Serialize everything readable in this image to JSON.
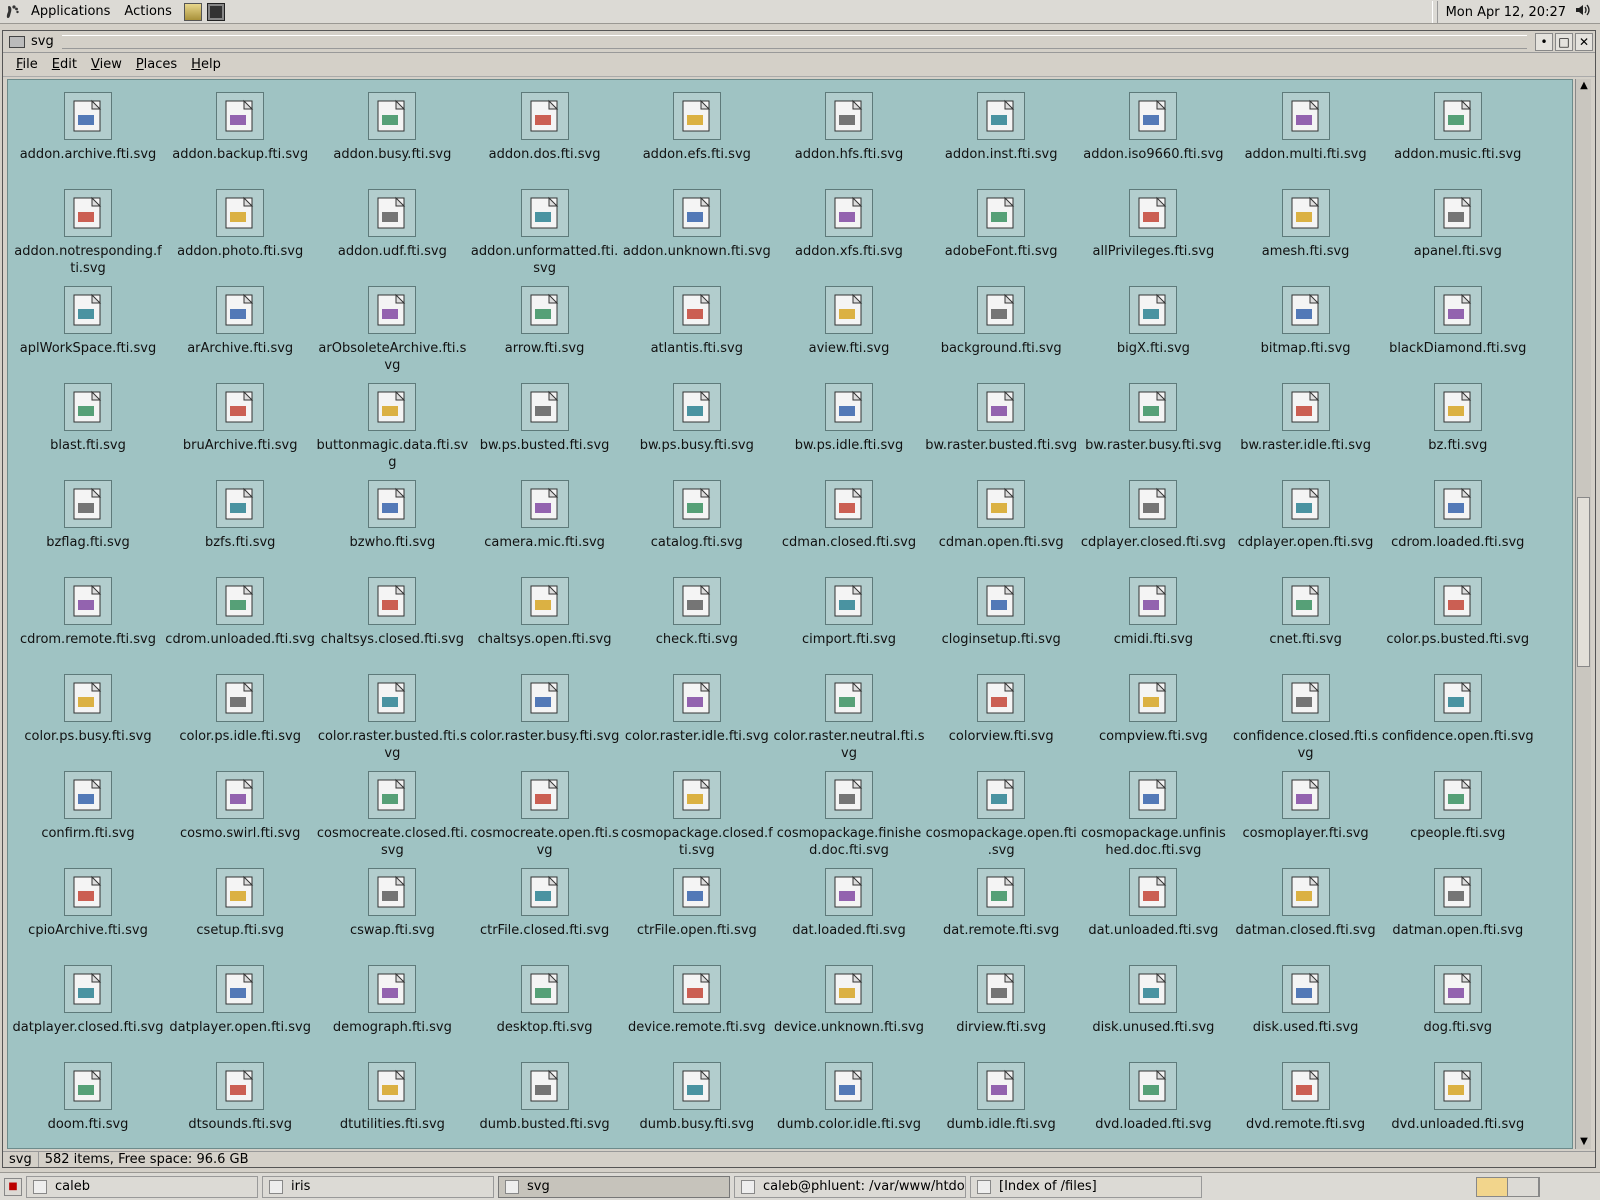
{
  "top_panel": {
    "menus": [
      "Applications",
      "Actions"
    ],
    "clock": "Mon Apr 12, 20:27",
    "icons": [
      "gnome-foot-icon",
      "notes-launcher-icon",
      "terminal-launcher-icon",
      "volume-icon"
    ]
  },
  "window": {
    "title": "svg",
    "menus": [
      {
        "key": "F",
        "rest": "ile"
      },
      {
        "key": "E",
        "rest": "dit"
      },
      {
        "key": "V",
        "rest": "iew"
      },
      {
        "key": "P",
        "rest": "laces"
      },
      {
        "key": "H",
        "rest": "elp"
      }
    ]
  },
  "files": [
    [
      "addon.archive.fti.svg",
      "addon.backup.fti.svg",
      "addon.busy.fti.svg",
      "addon.dos.fti.svg",
      "addon.efs.fti.svg",
      "addon.hfs.fti.svg",
      "addon.inst.fti.svg",
      "addon.iso9660.fti.svg",
      "addon.multi.fti.svg",
      "addon.music.fti.svg"
    ],
    [
      "addon.notresponding.fti.svg",
      "addon.photo.fti.svg",
      "addon.udf.fti.svg",
      "addon.unformatted.fti.svg",
      "addon.unknown.fti.svg",
      "addon.xfs.fti.svg",
      "adobeFont.fti.svg",
      "allPrivileges.fti.svg",
      "amesh.fti.svg",
      "apanel.fti.svg"
    ],
    [
      "aplWorkSpace.fti.svg",
      "arArchive.fti.svg",
      "arObsoleteArchive.fti.svg",
      "arrow.fti.svg",
      "atlantis.fti.svg",
      "aview.fti.svg",
      "background.fti.svg",
      "bigX.fti.svg",
      "bitmap.fti.svg",
      "blackDiamond.fti.svg"
    ],
    [
      "blast.fti.svg",
      "bruArchive.fti.svg",
      "buttonmagic.data.fti.svg",
      "bw.ps.busted.fti.svg",
      "bw.ps.busy.fti.svg",
      "bw.ps.idle.fti.svg",
      "bw.raster.busted.fti.svg",
      "bw.raster.busy.fti.svg",
      "bw.raster.idle.fti.svg",
      "bz.fti.svg"
    ],
    [
      "bzflag.fti.svg",
      "bzfs.fti.svg",
      "bzwho.fti.svg",
      "camera.mic.fti.svg",
      "catalog.fti.svg",
      "cdman.closed.fti.svg",
      "cdman.open.fti.svg",
      "cdplayer.closed.fti.svg",
      "cdplayer.open.fti.svg",
      "cdrom.loaded.fti.svg"
    ],
    [
      "cdrom.remote.fti.svg",
      "cdrom.unloaded.fti.svg",
      "chaltsys.closed.fti.svg",
      "chaltsys.open.fti.svg",
      "check.fti.svg",
      "cimport.fti.svg",
      "cloginsetup.fti.svg",
      "cmidi.fti.svg",
      "cnet.fti.svg",
      "color.ps.busted.fti.svg"
    ],
    [
      "color.ps.busy.fti.svg",
      "color.ps.idle.fti.svg",
      "color.raster.busted.fti.svg",
      "color.raster.busy.fti.svg",
      "color.raster.idle.fti.svg",
      "color.raster.neutral.fti.svg",
      "colorview.fti.svg",
      "compview.fti.svg",
      "confidence.closed.fti.svg",
      "confidence.open.fti.svg"
    ],
    [
      "confirm.fti.svg",
      "cosmo.swirl.fti.svg",
      "cosmocreate.closed.fti.svg",
      "cosmocreate.open.fti.svg",
      "cosmopackage.closed.fti.svg",
      "cosmopackage.finished.doc.fti.svg",
      "cosmopackage.open.fti.svg",
      "cosmopackage.unfinished.doc.fti.svg",
      "cosmoplayer.fti.svg",
      "cpeople.fti.svg"
    ],
    [
      "cpioArchive.fti.svg",
      "csetup.fti.svg",
      "cswap.fti.svg",
      "ctrFile.closed.fti.svg",
      "ctrFile.open.fti.svg",
      "dat.loaded.fti.svg",
      "dat.remote.fti.svg",
      "dat.unloaded.fti.svg",
      "datman.closed.fti.svg",
      "datman.open.fti.svg"
    ],
    [
      "datplayer.closed.fti.svg",
      "datplayer.open.fti.svg",
      "demograph.fti.svg",
      "desktop.fti.svg",
      "device.remote.fti.svg",
      "device.unknown.fti.svg",
      "dirview.fti.svg",
      "disk.unused.fti.svg",
      "disk.used.fti.svg",
      "dog.fti.svg"
    ],
    [
      "doom.fti.svg",
      "dtsounds.fti.svg",
      "dtutilities.fti.svg",
      "dumb.busted.fti.svg",
      "dumb.busy.fti.svg",
      "dumb.color.idle.fti.svg",
      "dumb.idle.fti.svg",
      "dvd.loaded.fti.svg",
      "dvd.remote.fti.svg",
      "dvd.unloaded.fti.svg"
    ]
  ],
  "status": {
    "location": "svg",
    "info": "582 items, Free space: 96.6 GB"
  },
  "taskbar": {
    "tasks": [
      "caleb",
      "iris",
      "svg",
      "caleb@phluent: /var/www/htdocs/w",
      "[Index of /files]"
    ],
    "active_index": 2
  },
  "colors": {
    "desktop_bg": "#9fc3c3",
    "panel_bg": "#dcdad5",
    "window_bg": "#d4d0c8"
  }
}
